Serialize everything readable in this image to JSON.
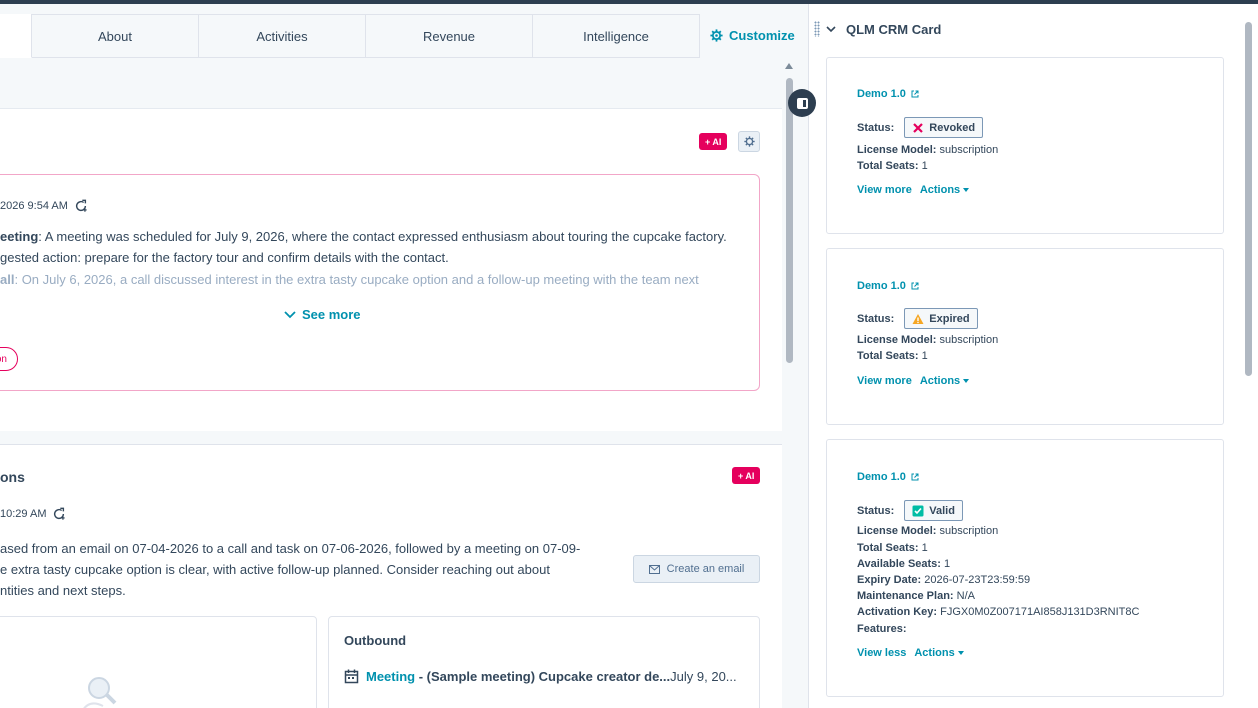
{
  "tabs": [
    "About",
    "Activities",
    "Revenue",
    "Intelligence"
  ],
  "customize_label": "Customize",
  "summary": {
    "ai_badge": "+ AI",
    "timestamp": "2026 9:54 AM",
    "line1_bold": "eeting",
    "line1_text": ": A meeting was scheduled for July 9, 2026, where the contact expressed enthusiasm about touring the cupcake factory.",
    "line2": "gested action: prepare for the factory tour and confirm details with the contact.",
    "line3_bold": "all",
    "line3_text": ": On July 6, 2026, a call discussed interest in the extra tasty cupcake option and a follow-up meeting with the team next",
    "see_more": "See more",
    "pill_label": "on"
  },
  "interactions": {
    "title": "ons",
    "ai_badge": "+ AI",
    "timestamp": "10:29 AM",
    "line1": "ased from an email on 07-04-2026 to a call and task on 07-06-2026, followed by a meeting on 07-09-",
    "line2": "e extra tasty cupcake option is clear, with active follow-up planned. Consider reaching out about",
    "line3": "ntities and next steps.",
    "create_email": "Create an email",
    "outbound_title": "Outbound",
    "meeting_link": "Meeting",
    "meeting_title": " - (Sample meeting) Cupcake creator de...",
    "meeting_date": "July 9, 20..."
  },
  "panel": {
    "title": "QLM CRM Card",
    "view_more": "View more",
    "view_less": "View less",
    "actions": "Actions",
    "labels": {
      "status": "Status:",
      "license_model": "License Model:",
      "total_seats": "Total Seats:",
      "available_seats": "Available Seats:",
      "expiry_date": "Expiry Date:",
      "maintenance_plan": "Maintenance Plan:",
      "activation_key": "Activation Key:",
      "features": "Features:"
    },
    "licenses": [
      {
        "name": "Demo 1.0",
        "status": "Revoked",
        "status_icon": "x-icon",
        "license_model": "subscription",
        "total_seats": "1"
      },
      {
        "name": "Demo 1.0",
        "status": "Expired",
        "status_icon": "warning-icon",
        "license_model": "subscription",
        "total_seats": "1"
      },
      {
        "name": "Demo 1.0",
        "status": "Valid",
        "status_icon": "check-icon",
        "license_model": "subscription",
        "total_seats": "1",
        "available_seats": "1",
        "expiry_date": "2026-07-23T23:59:59",
        "maintenance_plan": "N/A",
        "activation_key": "FJGX0M0Z007171AI858J131D3RNIT8C"
      }
    ]
  },
  "colors": {
    "accent": "#0091ae",
    "ai_pink": "#e5005d",
    "text": "#33475b",
    "revoked": "#e5005d",
    "expired": "#f5a623",
    "valid": "#00bda5"
  }
}
